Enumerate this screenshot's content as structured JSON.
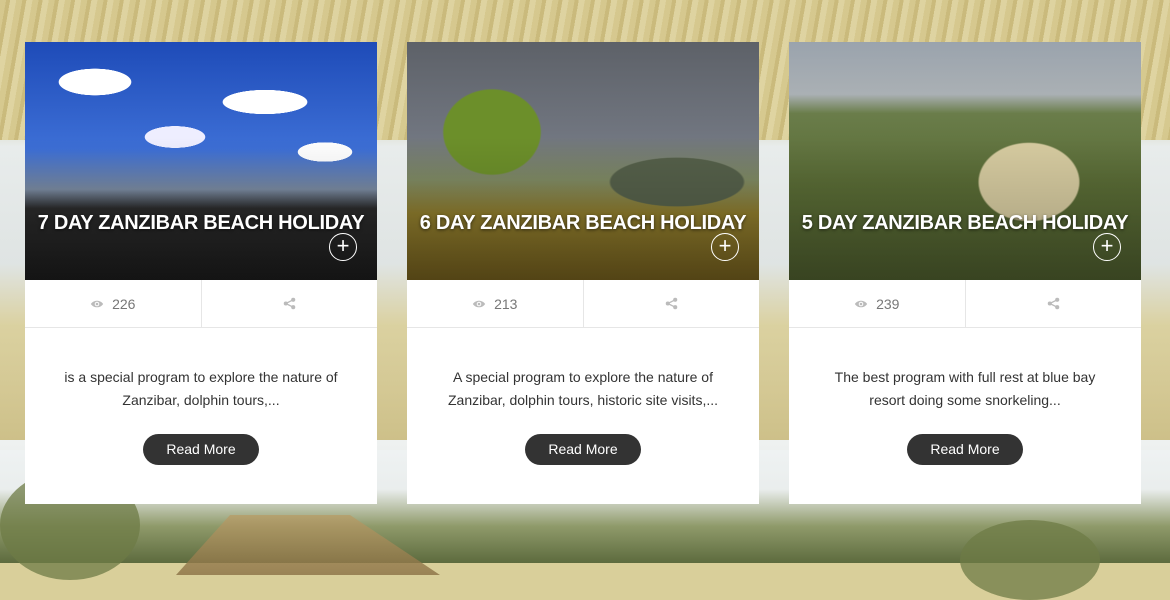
{
  "cards": [
    {
      "title": "7 DAY ZANZIBAR BEACH HOLIDAY",
      "views": "226",
      "description": "is a special program to explore the nature of Zanzibar, dolphin tours,...",
      "button_label": "Read More",
      "plus_icon": "+"
    },
    {
      "title": "6 DAY ZANZIBAR BEACH HOLIDAY",
      "views": "213",
      "description": "A special program to explore the nature of Zanzibar, dolphin tours, historic site visits,...",
      "button_label": "Read More",
      "plus_icon": "+"
    },
    {
      "title": "5 DAY ZANZIBAR BEACH HOLIDAY",
      "views": "239",
      "description": "The best program with full rest at blue bay resort doing some snorkeling...",
      "button_label": "Read More",
      "plus_icon": "+"
    }
  ],
  "colors": {
    "button_bg": "#333333",
    "stat_text": "#777777"
  },
  "icons": {
    "views": "eye-icon",
    "share": "share-icon",
    "expand": "plus-circle-icon"
  }
}
